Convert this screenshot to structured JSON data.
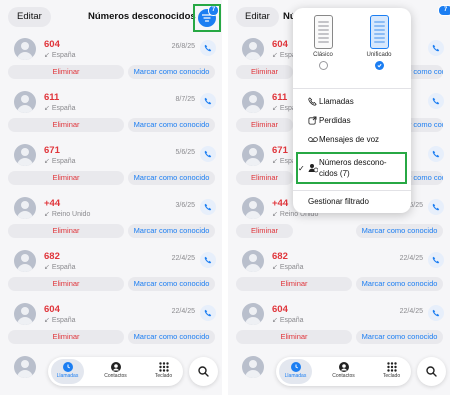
{
  "header": {
    "edit_label": "Editar",
    "title": "Números desconocidos",
    "filter_badge": "7"
  },
  "calls": [
    {
      "number": "604",
      "country": "España",
      "date": "26/8/25",
      "direction": "incoming"
    },
    {
      "number": "611",
      "country": "España",
      "date": "8/7/25",
      "direction": "incoming"
    },
    {
      "number": "671",
      "country": "España",
      "date": "5/6/25",
      "direction": "incoming"
    },
    {
      "number": "+44",
      "country": "Reino Unido",
      "date": "3/6/25",
      "direction": "incoming"
    },
    {
      "number": "682",
      "country": "España",
      "date": "22/4/25",
      "direction": "incoming"
    },
    {
      "number": "604",
      "country": "España",
      "date": "22/4/25",
      "direction": "incoming"
    }
  ],
  "row_actions": {
    "delete_label": "Eliminar",
    "mark_known_label": "Marcar como conocido"
  },
  "tabbar": {
    "calls": "Llamadas",
    "contacts": "Contactos",
    "keypad": "Teclado"
  },
  "filter_menu": {
    "layout_options": [
      {
        "label": "Clásico",
        "selected": false
      },
      {
        "label": "Unificado",
        "selected": true
      }
    ],
    "items": [
      {
        "label": "Llamadas",
        "icon": "phone-icon",
        "checked": false
      },
      {
        "label": "Perdidas",
        "icon": "missed-call-icon",
        "checked": false
      },
      {
        "label": "Mensajes de voz",
        "icon": "voicemail-icon",
        "checked": false
      },
      {
        "label_line1": "Números descono-",
        "label_line2": "cidos (7)",
        "icon": "unknown-caller-icon",
        "checked": true
      }
    ],
    "manage_label": "Gestionar filtrado"
  },
  "colors": {
    "accent": "#1c7ef2",
    "danger": "#e0353b",
    "highlight": "#27a844"
  }
}
